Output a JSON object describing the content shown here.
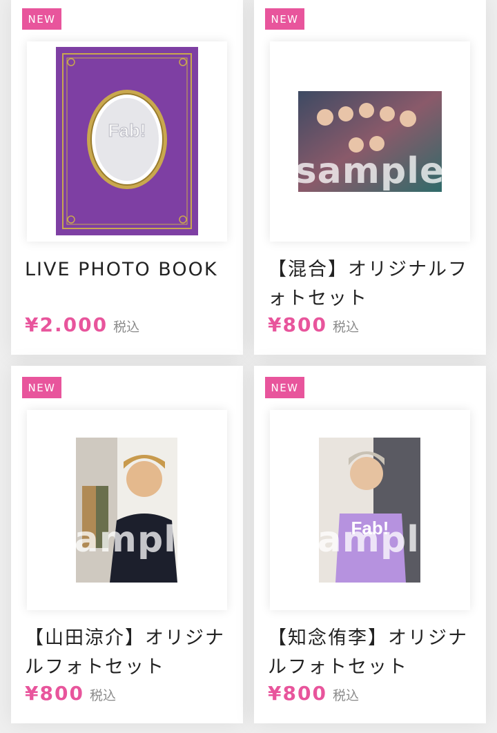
{
  "products": [
    {
      "badge": "NEW",
      "title": "LIVE PHOTO BOOK",
      "price": "¥2.000",
      "tax": "税込"
    },
    {
      "badge": "NEW",
      "title": "【混合】オリジナルフォトセット",
      "price": "¥800",
      "tax": "税込",
      "watermark": "sample"
    },
    {
      "badge": "NEW",
      "title": "【山田涼介】オリジナルフォトセット",
      "price": "¥800",
      "tax": "税込",
      "watermark": "sample"
    },
    {
      "badge": "NEW",
      "title": "【知念侑李】オリジナルフォトセット",
      "price": "¥800",
      "tax": "税込",
      "watermark": "sample"
    }
  ],
  "colors": {
    "accent": "#e8559c",
    "tax": "#8a8a8a",
    "book_purple": "#7e3fa3",
    "gold": "#c9a84e"
  }
}
